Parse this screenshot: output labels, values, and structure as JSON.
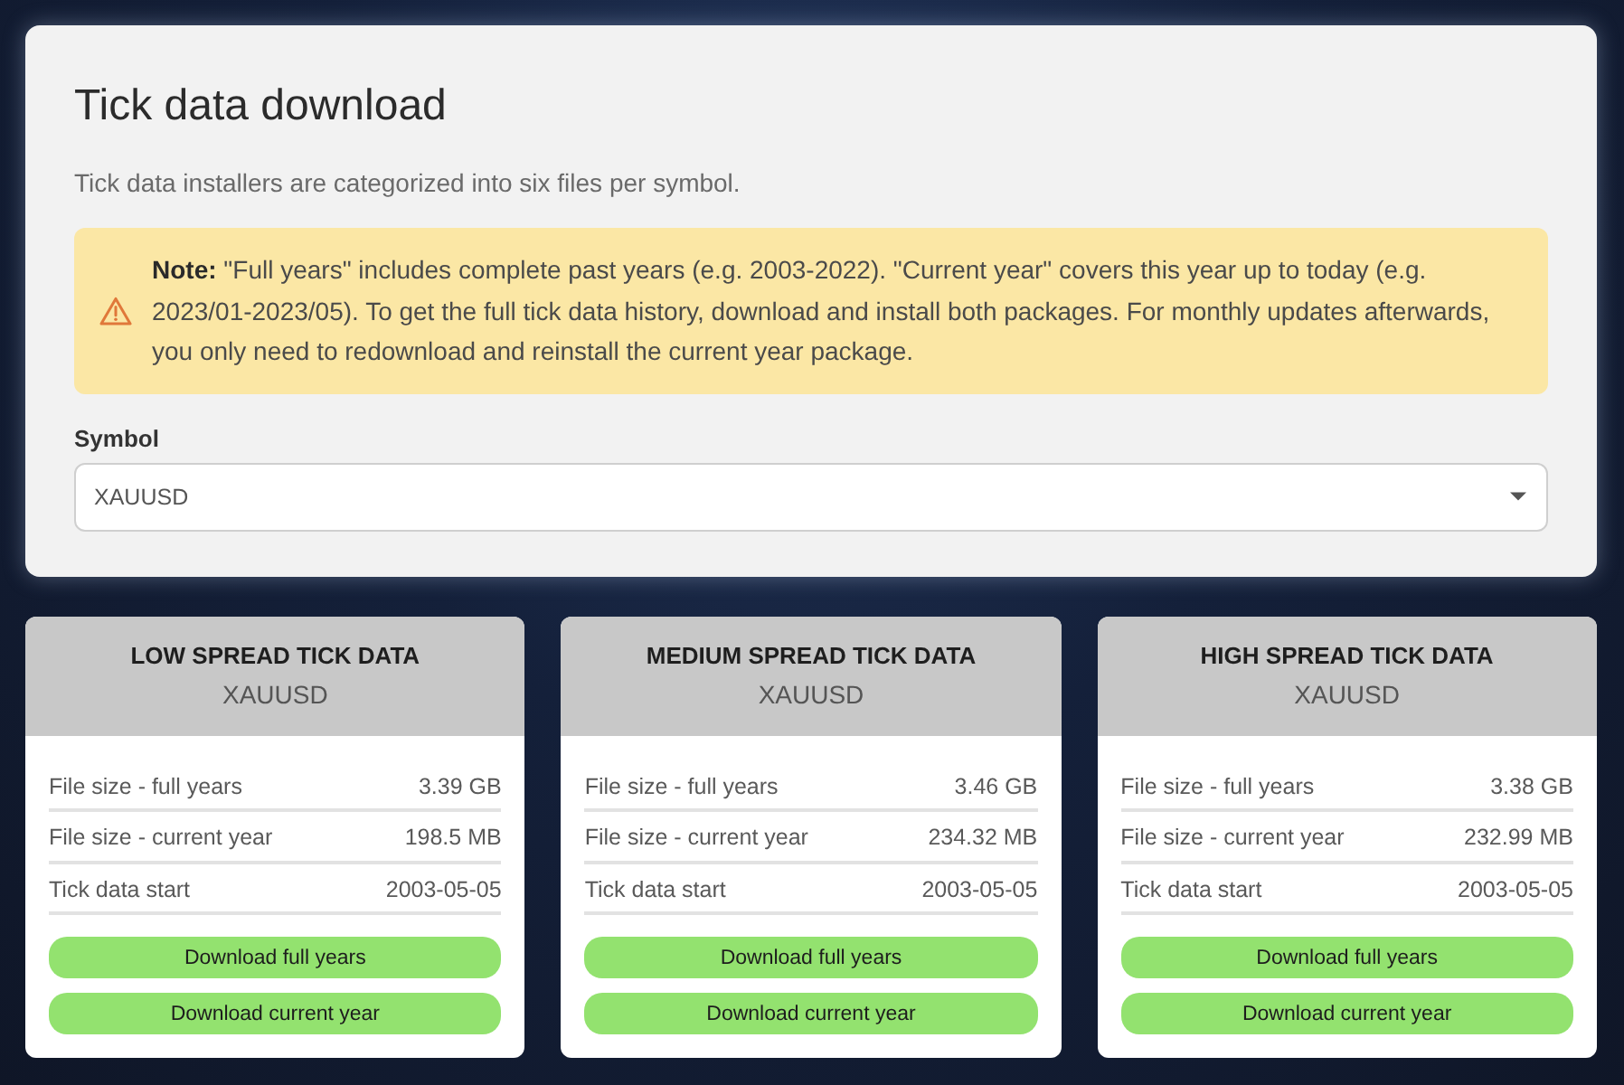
{
  "panel": {
    "title": "Tick data download",
    "subtitle": "Tick data installers are categorized into six files per symbol.",
    "note": "**Note:** \"Full years\" includes complete past years (e.g. 2003-2022). \"Current year\" covers this year up to today (e.g. 2023/01-2023/05). To get the full tick data history, download and install both packages. For monthly updates afterwards, you only need to redownload and reinstall the current year package.",
    "symbol_field": {
      "label": "Symbol",
      "value": "XAUUSD"
    }
  },
  "cards": [
    {
      "title": "LOW SPREAD TICK DATA",
      "symbol": "XAUUSD",
      "rows": [
        {
          "label": "File size - full years",
          "value": "3.39 GB"
        },
        {
          "label": "File size - current year",
          "value": "198.5 MB"
        },
        {
          "label": "Tick data start",
          "value": "2003-05-05"
        }
      ],
      "buttons": [
        "Download full years",
        "Download current year"
      ]
    },
    {
      "title": "MEDIUM SPREAD TICK DATA",
      "symbol": "XAUUSD",
      "rows": [
        {
          "label": "File size - full years",
          "value": "3.46 GB"
        },
        {
          "label": "File size - current year",
          "value": "234.32 MB"
        },
        {
          "label": "Tick data start",
          "value": "2003-05-05"
        }
      ],
      "buttons": [
        "Download full years",
        "Download current year"
      ]
    },
    {
      "title": "HIGH SPREAD TICK DATA",
      "symbol": "XAUUSD",
      "rows": [
        {
          "label": "File size - full years",
          "value": "3.38 GB"
        },
        {
          "label": "File size - current year",
          "value": "232.99 MB"
        },
        {
          "label": "Tick data start",
          "value": "2003-05-05"
        }
      ],
      "buttons": [
        "Download full years",
        "Download current year"
      ]
    }
  ]
}
